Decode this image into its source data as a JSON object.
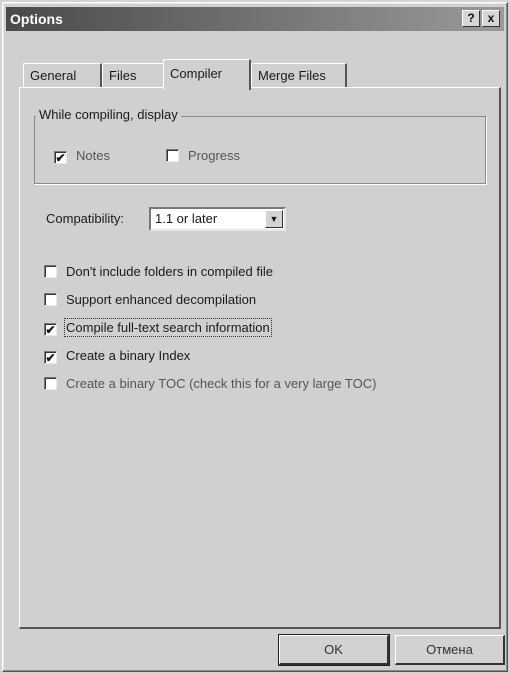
{
  "window": {
    "title": "Options",
    "help_button": "?",
    "close_button": "x"
  },
  "tabs": [
    {
      "label": "General"
    },
    {
      "label": "Files"
    },
    {
      "label": "Compiler"
    },
    {
      "label": "Merge Files"
    }
  ],
  "active_tab": "Compiler",
  "group": {
    "legend": "While compiling, display",
    "options": [
      {
        "label": "Notes",
        "checked": true
      },
      {
        "label": "Progress",
        "checked": false
      }
    ]
  },
  "compatibility": {
    "label": "Compatibility:",
    "value": "1.1 or later"
  },
  "options": [
    {
      "label": "Don't include folders in compiled file",
      "checked": false
    },
    {
      "label": "Support enhanced decompilation",
      "checked": false
    },
    {
      "label": "Compile full-text search information",
      "checked": true
    },
    {
      "label": "Create a binary Index",
      "checked": true
    },
    {
      "label": "Create a binary TOC (check this for a very large TOC)",
      "checked": false
    }
  ],
  "buttons": {
    "ok": "OK",
    "cancel": "Отмена"
  },
  "check_glyph": "✔"
}
